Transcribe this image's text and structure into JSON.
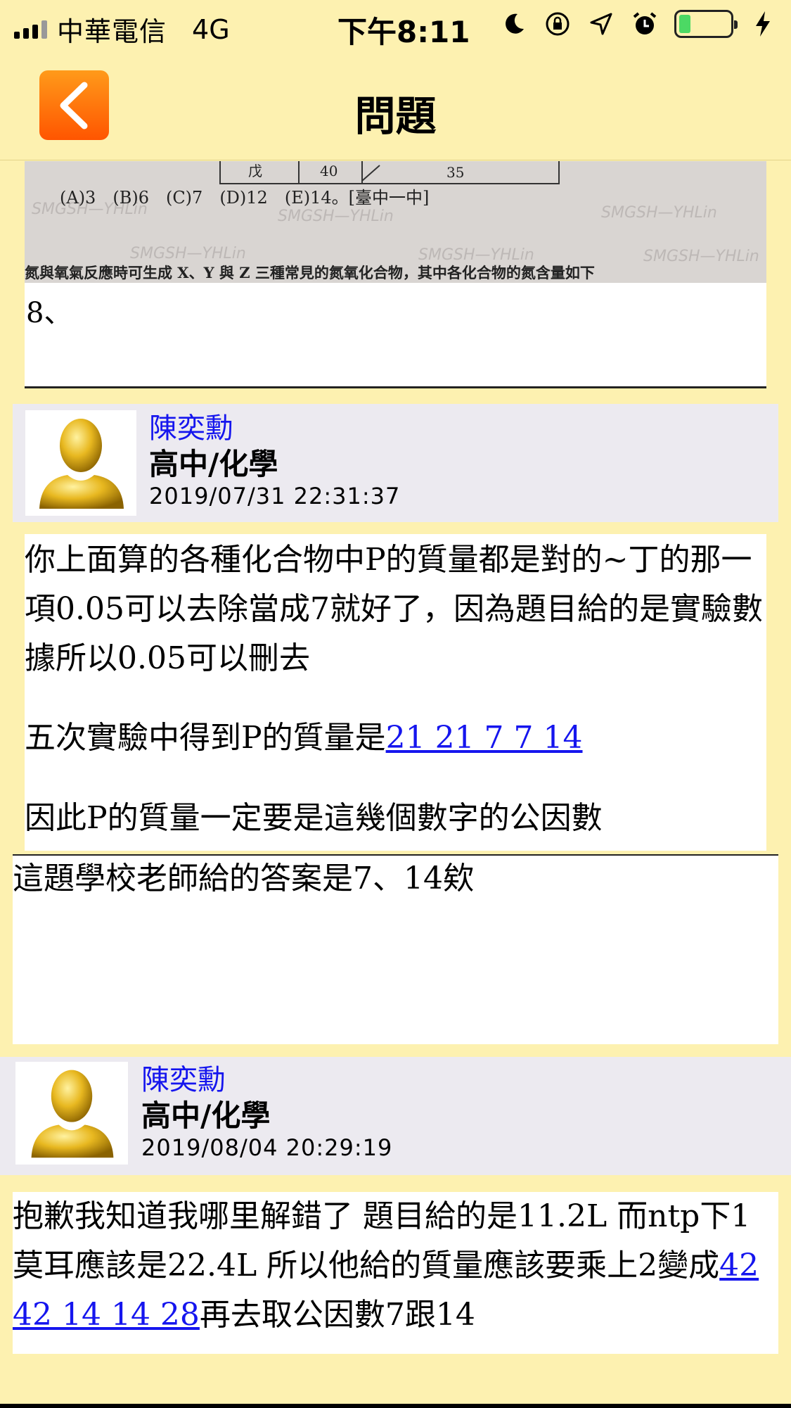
{
  "status_bar": {
    "carrier": "中華電信",
    "network": "4G",
    "time": "下午8:11"
  },
  "nav": {
    "title": "問題",
    "back_icon": "chevron-left-icon"
  },
  "question": {
    "image_text": {
      "table_row_label": "戊",
      "table_value_1": "40",
      "table_value_2": "35",
      "choices": "(A)3　(B)6　(C)7　(D)12　(E)14。[臺中一中]",
      "next_question": "氮與氧氣反應時可生成 X、Y 與 Z 三種常見的氮氧化合物，其中各化合物的氮含量如下",
      "watermark": "SMGSH—YHLin"
    },
    "text": "8、"
  },
  "posts": [
    {
      "user_name": "陳奕勳",
      "user_role": "高中/化學",
      "timestamp": "2019/07/31 22:31:37",
      "paragraph_1": "你上面算的各種化合物中P的質量都是對的~丁的那一項0.05可以去除當成7就好了，因為題目給的是實驗數據所以0.05可以刪去",
      "paragraph_2_prefix": "五次實驗中得到P的質量是",
      "paragraph_2_link": "21 21 7 7 14",
      "paragraph_3": "因此P的質量一定要是這幾個數字的公因數",
      "reply": "這題學校老師給的答案是7、14欸"
    },
    {
      "user_name": "陳奕勳",
      "user_role": "高中/化學",
      "timestamp": "2019/08/04 20:29:19",
      "body_prefix": "抱歉我知道我哪里解錯了 題目給的是11.2L 而ntp下1莫耳應該是22.4L 所以他給的質量應該要乘上2變成",
      "body_link": "42 42 14 14 28",
      "body_suffix": "再去取公因數7跟14"
    }
  ],
  "colors": {
    "background": "#fdf1b0",
    "link": "#1515ee",
    "back_button": "#ff6a00",
    "header_band": "#eceaf0"
  }
}
